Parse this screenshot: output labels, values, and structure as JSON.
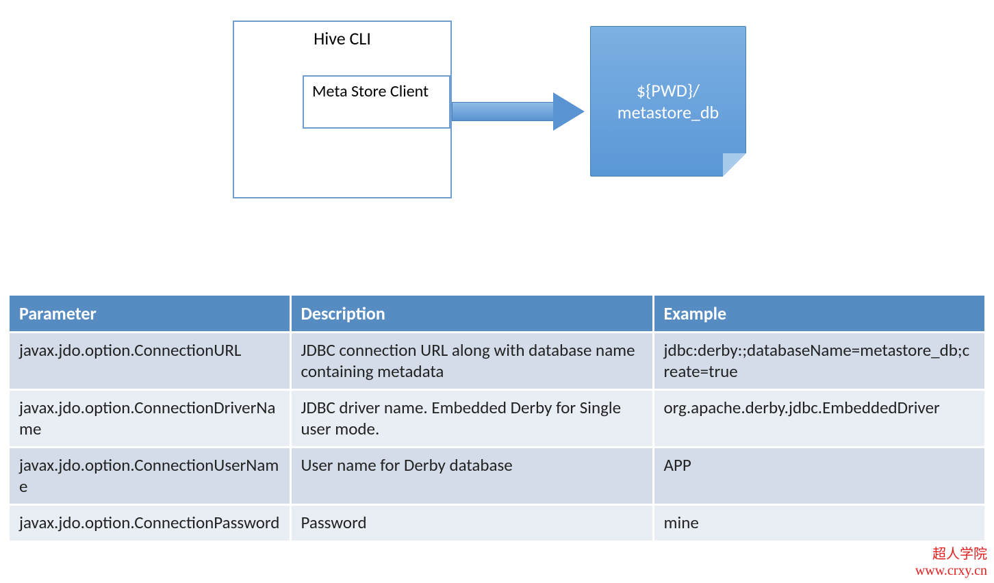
{
  "diagram": {
    "hive_cli_label": "Hive CLI",
    "meta_store_client_label": "Meta Store Client",
    "note_line1": "${PWD}/",
    "note_line2": "metastore_db"
  },
  "table": {
    "headers": {
      "parameter": "Parameter",
      "description": "Description",
      "example": "Example"
    },
    "rows": [
      {
        "parameter": "javax.jdo.option.ConnectionURL",
        "description": "JDBC connection URL along with database name containing metadata",
        "example": "jdbc:derby:;databaseName=metastore_db;create=true"
      },
      {
        "parameter": "javax.jdo.option.ConnectionDriverName",
        "description": "JDBC driver name. Embedded Derby for Single user mode.",
        "example": "org.apache.derby.jdbc.EmbeddedDriver"
      },
      {
        "parameter": "javax.jdo.option.ConnectionUserName",
        "description": "User name for Derby database",
        "example": "APP"
      },
      {
        "parameter": "javax.jdo.option.ConnectionPassword",
        "description": "Password",
        "example": "mine"
      }
    ]
  },
  "watermark": {
    "line1": "超人学院",
    "line2": "www.crxy.cn"
  }
}
